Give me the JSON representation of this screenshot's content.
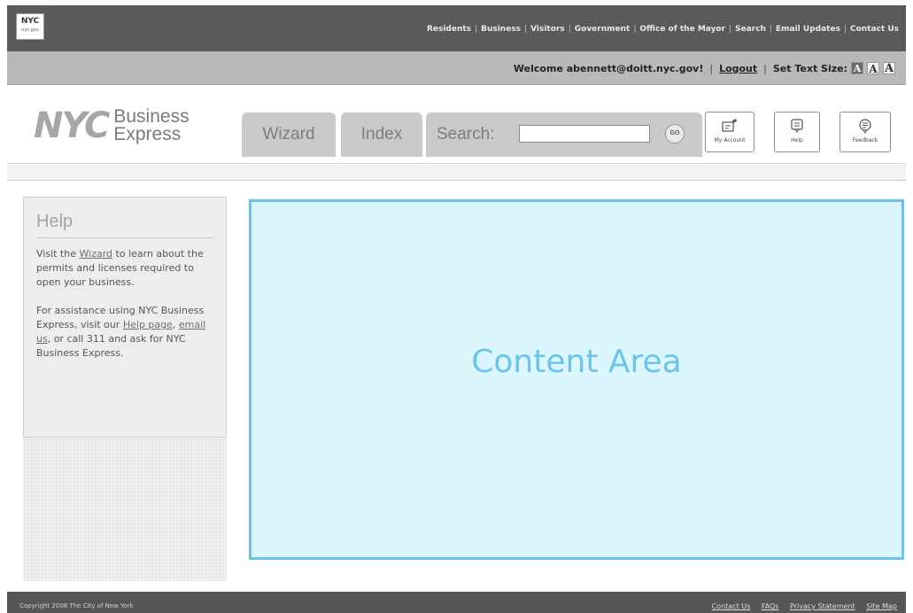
{
  "top_nav": {
    "logo_text": "NYC",
    "logo_sub": "nyc.gov",
    "links": [
      "Residents",
      "Business",
      "Visitors",
      "Government",
      "Office of the Mayor",
      "Search",
      "Email Updates",
      "Contact Us"
    ]
  },
  "welcome_bar": {
    "welcome_text": "Welcome abennett@doitt.nyc.gov!",
    "logout_label": "Logout",
    "text_size_label": "Set Text Size:",
    "text_sizes": [
      "A",
      "A",
      "A"
    ]
  },
  "header": {
    "brand_nyc": "NYC",
    "brand_line1": "Business",
    "brand_line2": "Express",
    "tabs": {
      "wizard": "Wizard",
      "index": "Index",
      "search": "Search:"
    },
    "search": {
      "value": "",
      "placeholder": ""
    },
    "go_label": "GO",
    "icon_buttons": {
      "account": "My Account",
      "help": "Help",
      "feedback": "Feedback"
    }
  },
  "sidebar": {
    "help_title": "Help",
    "para1_before": "Visit the ",
    "para1_link": "Wizard",
    "para1_after": " to learn about the permits and licenses required to open your business.",
    "para2_before": "For assistance using NYC Business Express, visit our ",
    "para2_link1": "Help page",
    "para2_mid": ", ",
    "para2_link2": "email us",
    "para2_after": ", or call 311 and ask for NYC Business Express."
  },
  "content": {
    "label": "Content Area"
  },
  "footer": {
    "copyright": "Copyright 2008 The City of New York",
    "links": [
      "Contact Us",
      "FAQs",
      "Privacy Statement",
      "Site Map"
    ]
  },
  "colors": {
    "content_bg": "#dcf6fd",
    "content_border": "#68c6ea",
    "content_text": "#6dc4ea"
  }
}
